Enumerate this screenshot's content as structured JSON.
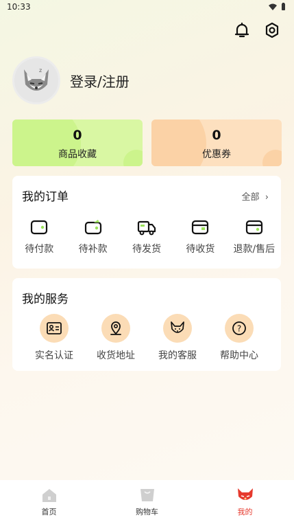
{
  "status_bar": {
    "time": "10:33"
  },
  "profile": {
    "login_label": "登录/注册"
  },
  "stats": [
    {
      "value": "0",
      "label": "商品收藏",
      "color": "#d9f7a3"
    },
    {
      "value": "0",
      "label": "优惠券",
      "color": "#fde0bf"
    }
  ],
  "orders": {
    "title": "我的订单",
    "all_label": "全部",
    "items": [
      {
        "label": "待付款",
        "icon": "wallet-icon"
      },
      {
        "label": "待补款",
        "icon": "wallet-add-icon"
      },
      {
        "label": "待发货",
        "icon": "truck-icon"
      },
      {
        "label": "待收货",
        "icon": "card-icon"
      },
      {
        "label": "退款/售后",
        "icon": "refund-card-icon"
      }
    ]
  },
  "services": {
    "title": "我的服务",
    "items": [
      {
        "label": "实名认证",
        "icon": "id-card-icon"
      },
      {
        "label": "收货地址",
        "icon": "location-icon"
      },
      {
        "label": "我的客服",
        "icon": "fox-icon"
      },
      {
        "label": "帮助中心",
        "icon": "help-icon"
      }
    ]
  },
  "tabbar": [
    {
      "label": "首页",
      "icon": "home-icon"
    },
    {
      "label": "购物车",
      "icon": "cart-icon"
    },
    {
      "label": "我的",
      "icon": "mine-fox-icon",
      "active": true
    }
  ],
  "colors": {
    "accent": "#e63a2e",
    "icon_green": "#9be35b",
    "service_circle": "#fbdcb6"
  }
}
